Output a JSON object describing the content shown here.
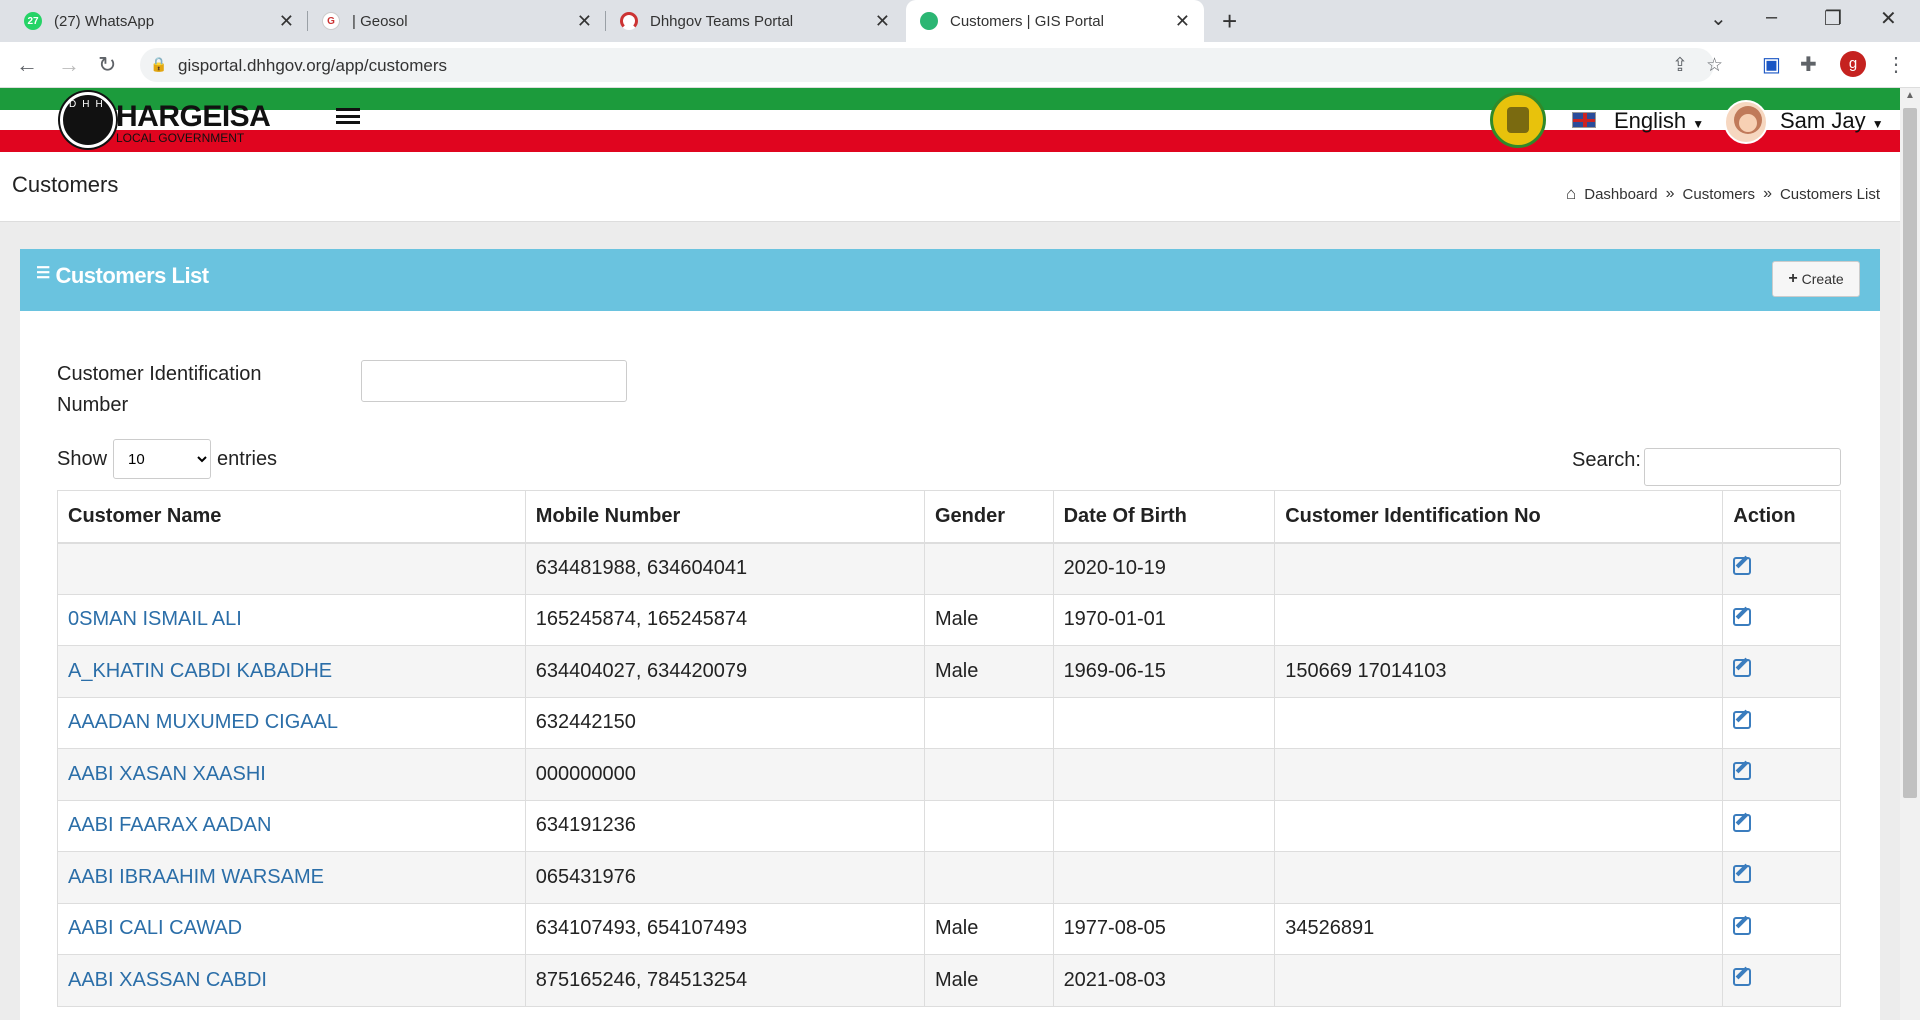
{
  "browser": {
    "tabs": [
      {
        "title": "(27) WhatsApp",
        "badge": "27"
      },
      {
        "title": "| Geosol",
        "badge": "G"
      },
      {
        "title": "Dhhgov Teams Portal",
        "badge": ""
      },
      {
        "title": "Customers | GIS Portal",
        "badge": ""
      }
    ],
    "url": "gisportal.dhhgov.org/app/customers",
    "profile_initial": "g"
  },
  "header": {
    "brand": "HARGEISA",
    "brand_sub": "LOCAL GOVERNMENT",
    "language": "English",
    "user": "Sam Jay"
  },
  "page": {
    "title": "Customers",
    "breadcrumb": [
      "Dashboard",
      "Customers",
      "Customers List"
    ]
  },
  "panel": {
    "title": "Customers List",
    "create_label": "Create",
    "cid_label": "Customer Identification Number",
    "show_label": "Show",
    "entries_label": "entries",
    "entries_value": "10",
    "search_label": "Search:"
  },
  "table": {
    "headers": [
      "Customer Name",
      "Mobile Number",
      "Gender",
      "Date Of Birth",
      "Customer Identification No",
      "Action"
    ],
    "rows": [
      {
        "name": "",
        "mobile": "634481988, 634604041",
        "gender": "",
        "dob": "2020-10-19",
        "cid": ""
      },
      {
        "name": "0SMAN ISMAIL ALI",
        "mobile": "165245874, 165245874",
        "gender": "Male",
        "dob": "1970-01-01",
        "cid": ""
      },
      {
        "name": "A_KHATIN CABDI KABADHE",
        "mobile": "634404027, 634420079",
        "gender": "Male",
        "dob": "1969-06-15",
        "cid": "150669 17014103"
      },
      {
        "name": "AAADAN MUXUMED CIGAAL",
        "mobile": "632442150",
        "gender": "",
        "dob": "",
        "cid": ""
      },
      {
        "name": "AABI XASAN XAASHI",
        "mobile": "000000000",
        "gender": "",
        "dob": "",
        "cid": ""
      },
      {
        "name": "AABI FAARAX AADAN",
        "mobile": "634191236",
        "gender": "",
        "dob": "",
        "cid": ""
      },
      {
        "name": "AABI IBRAAHIM WARSAME",
        "mobile": "065431976",
        "gender": "",
        "dob": "",
        "cid": ""
      },
      {
        "name": "AABI CALI CAWAD",
        "mobile": "634107493, 654107493",
        "gender": "Male",
        "dob": "1977-08-05",
        "cid": "34526891"
      },
      {
        "name": "AABI XASSAN CABDI",
        "mobile": "875165246, 784513254",
        "gender": "Male",
        "dob": "2021-08-03",
        "cid": ""
      }
    ]
  },
  "icons": {
    "home": "home-icon",
    "list": "list-icon",
    "plus": "plus-icon",
    "edit": "edit-icon"
  },
  "colors": {
    "panel_header": "#6ac3df",
    "link": "#2b6ea8",
    "flag_green": "#1c9b3c",
    "flag_red": "#e0051f"
  }
}
